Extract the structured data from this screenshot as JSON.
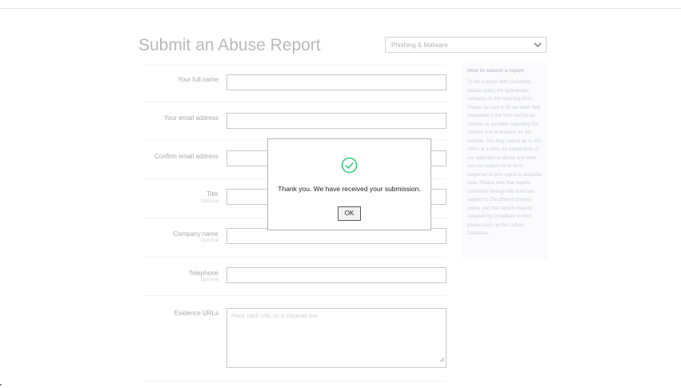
{
  "page": {
    "title": "Submit an Abuse Report"
  },
  "category_select": {
    "value": "Phishing & Malware",
    "icon": "chevron-down-icon"
  },
  "form": {
    "full_name_label": "Your full name",
    "email_label": "Your email address",
    "confirm_email_label": "Confirm email address",
    "title_label": "Title",
    "title_sub": "Optional",
    "company_label": "Company name",
    "company_sub": "Optional",
    "telephone_label": "Telephone",
    "telephone_sub": "Optional",
    "evidence_label": "Evidence URLs",
    "evidence_placeholder": "Place each URL on a separate line"
  },
  "help": {
    "title": "How to submit a report",
    "body": "To file a report with Cloudflare, please select the appropriate category on the reporting form. Please be sure to fill out each field requested in the form and be as specific as possible regarding the content and its location on the website. You may submit up to 250 URLs at a time. An explanation of our approach to abuse and what you can expect us to do in response to your report is available here. Please note that reports submitted through this form are subject to Cloudflare's privacy policy, and that reports may be released by Cloudflare to third parties such as the Lumen Database."
  },
  "dialog": {
    "message": "Thank you. We have received your submission.",
    "ok_label": "OK",
    "icon": "check-circle-icon",
    "accent": "#2ecc71"
  }
}
